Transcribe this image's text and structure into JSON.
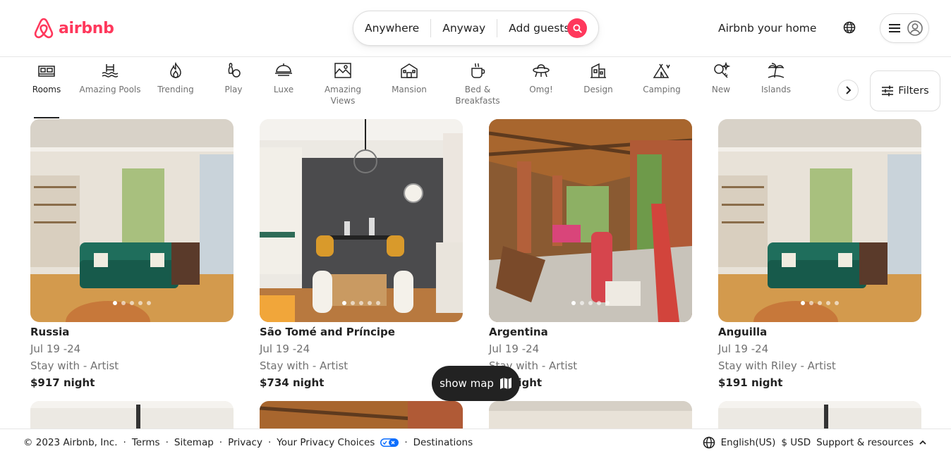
{
  "header": {
    "brand": "airbnb",
    "search": {
      "where": "Anywhere",
      "when": "Anyway",
      "who": "Add guests"
    },
    "host_link": "Airbnb your home"
  },
  "categories": [
    {
      "label": "Rooms",
      "icon": "rooms-icon",
      "active": true
    },
    {
      "label": "Amazing Pools",
      "icon": "pool-icon"
    },
    {
      "label": "Trending",
      "icon": "flame-icon"
    },
    {
      "label": "Play",
      "icon": "bowling-icon"
    },
    {
      "label": "Luxe",
      "icon": "luxe-icon"
    },
    {
      "label": "Amazing Views",
      "icon": "views-icon"
    },
    {
      "label": "Mansion",
      "icon": "mansion-icon"
    },
    {
      "label": "Bed & Breakfasts",
      "icon": "coffee-icon"
    },
    {
      "label": "Omg!",
      "icon": "ufo-icon"
    },
    {
      "label": "Design",
      "icon": "design-icon"
    },
    {
      "label": "Camping",
      "icon": "tent-icon"
    },
    {
      "label": "New",
      "icon": "sparkle-key-icon"
    },
    {
      "label": "Islands",
      "icon": "palm-icon"
    }
  ],
  "filters_label": "Filters",
  "listings": [
    {
      "title": "Russia",
      "dates": "Jul 19 -24",
      "host": "Stay with - Artist",
      "price": "$917 night"
    },
    {
      "title": "São Tomé and Príncipe",
      "dates": "Jul 19 -24",
      "host": "Stay with - Artist",
      "price": "$734 night"
    },
    {
      "title": "Argentina",
      "dates": "Jul 19 -24",
      "host": "Stay with - Artist",
      "price": "$__ night"
    },
    {
      "title": "Anguilla",
      "dates": "Jul 19 -24",
      "host": "Stay with Riley - Artist",
      "price": "$191 night"
    }
  ],
  "show_map_label": "show map",
  "footer": {
    "copyright": "© 2023 Airbnb, Inc.",
    "links": [
      "Terms",
      "Sitemap",
      "Privacy",
      "Your Privacy Choices",
      "Destinations"
    ],
    "language": "English(US)",
    "currency": "$ USD",
    "support": "Support & resources"
  },
  "colors": {
    "brand": "#ff385c",
    "text": "#222222",
    "muted": "#717171",
    "border": "#dddddd"
  }
}
